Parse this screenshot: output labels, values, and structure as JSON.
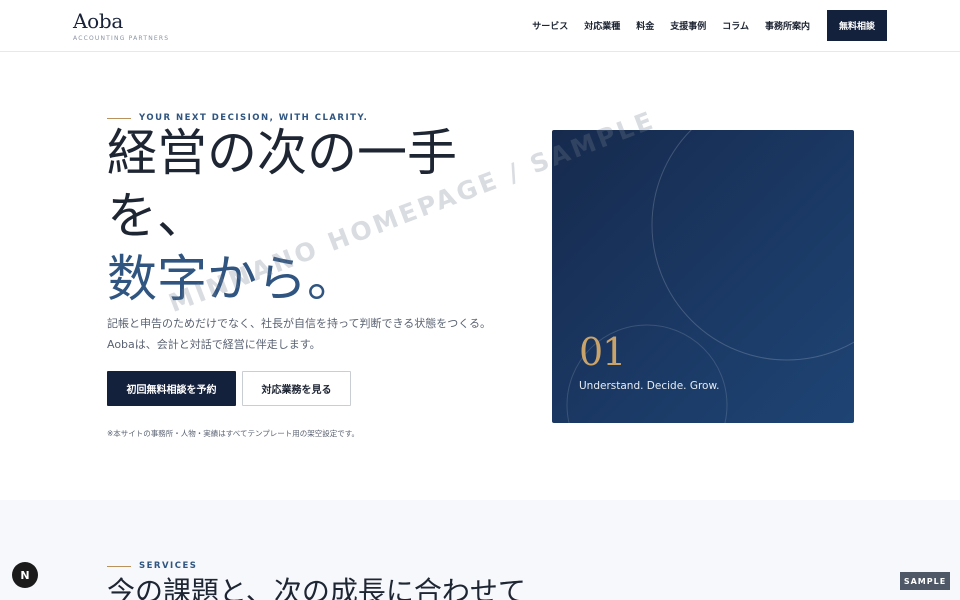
{
  "header": {
    "logo_name": "Aoba",
    "logo_sub": "ACCOUNTING PARTNERS",
    "nav": [
      "サービス",
      "対応業種",
      "料金",
      "支援事例",
      "コラム",
      "事務所案内"
    ],
    "cta": "無料相談"
  },
  "hero": {
    "eyebrow": "YOUR NEXT DECISION, WITH CLARITY.",
    "headline_1": "経営の次の一手",
    "headline_2": "を、",
    "headline_3": "数字から。",
    "desc_1": "記帳と申告のためだけでなく、社長が自信を持って判断できる状態をつくる。",
    "desc_2": "Aobaは、会計と対話で経営に伴走します。",
    "btn_primary": "初回無料相談を予約",
    "btn_secondary": "対応業務を見る",
    "note": "※本サイトの事務所・人物・実績はすべてテンプレート用の架空設定です。",
    "card_num": "01",
    "card_tag": "Understand. Decide. Grow.",
    "accent_color": "#2f5580",
    "gold_color": "#c9a36a",
    "navy_color": "#14213d"
  },
  "watermark": "MINNANO HOMEPAGE / SAMPLE",
  "services": {
    "eyebrow": "SERVICES",
    "heading": "今の課題と、次の成長に合わせて"
  },
  "badges": {
    "n_badge": "N",
    "sample": "SAMPLE"
  }
}
